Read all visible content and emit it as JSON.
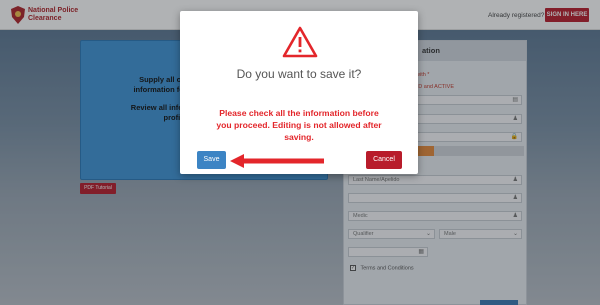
{
  "header": {
    "brand_line1": "National Police",
    "brand_line2": "Clearance",
    "already_registered": "Already registered?",
    "sign_in_label": "SIGN IN HERE"
  },
  "info_card": {
    "line1": "Supply all other need",
    "line2": "information for the trans",
    "line3": "Review all information an",
    "line4": "profile."
  },
  "pdf_tutorial_label": "PDF Tutorial",
  "form": {
    "heading_fragment": "ation",
    "red_fragment1": "with *",
    "red_fragment2": "ALID and ACTIVE",
    "last_name_placeholder": "Last Name/Apelido",
    "middle_placeholder": "Medic",
    "qualifier_placeholder": "Qualifier",
    "gender_value": "Male",
    "terms_label": "Terms and Conditions"
  },
  "modal": {
    "title": "Do you want to save it?",
    "warning_line1": "Please check all the information before",
    "warning_line2": "you proceed. Editing is not allowed after",
    "warning_line3": "saving.",
    "save_label": "Save",
    "cancel_label": "Cancel"
  },
  "colors": {
    "brand_red": "#b81c2b",
    "warning_red": "#e3262b",
    "save_blue": "#3c84c4",
    "info_blue": "#3f94d6"
  },
  "icons": [
    "warning-triangle-icon",
    "user-icon",
    "lock-icon",
    "calendar-icon",
    "chevron-down-icon",
    "red-arrow-annotation"
  ]
}
